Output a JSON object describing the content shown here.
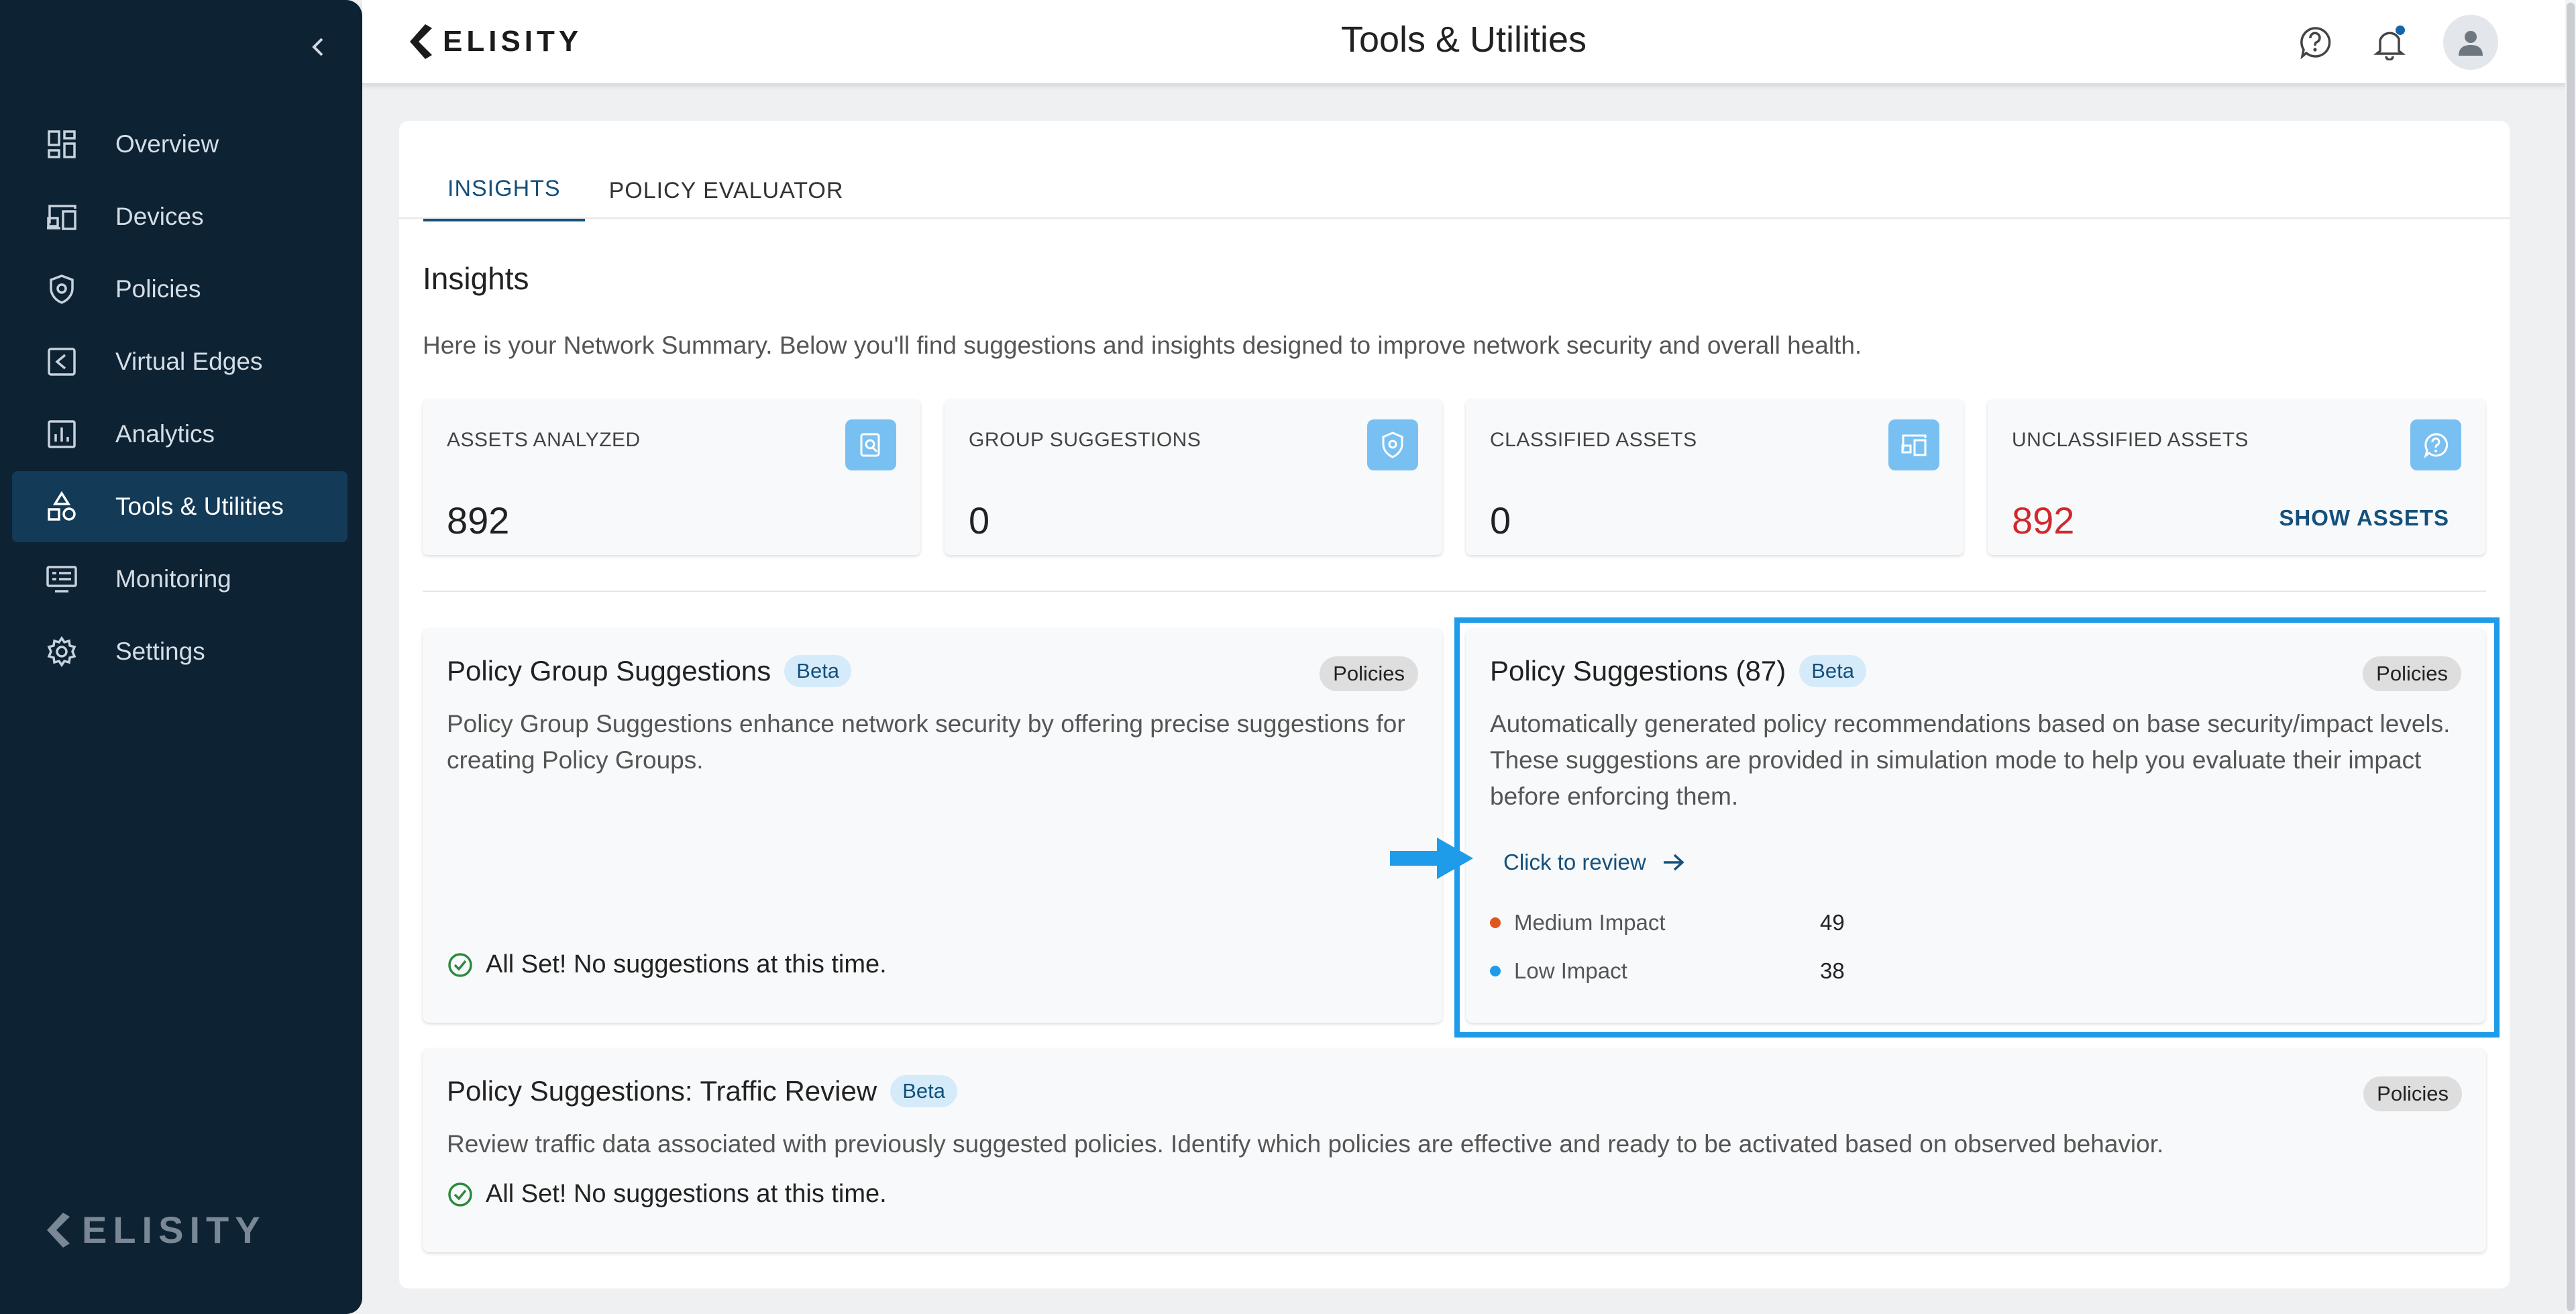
{
  "sidebar": {
    "items": [
      {
        "label": "Overview",
        "icon": "dashboard-icon"
      },
      {
        "label": "Devices",
        "icon": "devices-icon"
      },
      {
        "label": "Policies",
        "icon": "shield-icon"
      },
      {
        "label": "Virtual Edges",
        "icon": "edge-icon"
      },
      {
        "label": "Analytics",
        "icon": "analytics-icon"
      },
      {
        "label": "Tools & Utilities",
        "icon": "tools-icon",
        "active": true
      },
      {
        "label": "Monitoring",
        "icon": "monitor-icon"
      },
      {
        "label": "Settings",
        "icon": "gear-icon"
      }
    ],
    "logo_text": "ELISITY"
  },
  "header": {
    "brand": "ELISITY",
    "title": "Tools & Utilities"
  },
  "tabs": [
    {
      "label": "INSIGHTS",
      "active": true
    },
    {
      "label": "POLICY EVALUATOR",
      "active": false
    }
  ],
  "insights": {
    "title": "Insights",
    "subtitle": "Here is your Network Summary. Below you'll find suggestions and insights designed to improve network security and overall health."
  },
  "stats": [
    {
      "label": "ASSETS ANALYZED",
      "value": "892",
      "icon": "asset-search-icon"
    },
    {
      "label": "GROUP SUGGESTIONS",
      "value": "0",
      "icon": "group-shield-icon"
    },
    {
      "label": "CLASSIFIED ASSETS",
      "value": "0",
      "icon": "classified-devices-icon"
    },
    {
      "label": "UNCLASSIFIED ASSETS",
      "value": "892",
      "icon": "question-icon",
      "action": "SHOW ASSETS"
    }
  ],
  "cards": {
    "group": {
      "title": "Policy Group Suggestions",
      "badge": "Beta",
      "tag": "Policies",
      "description": "Policy Group Suggestions enhance network security by offering precise suggestions for creating Policy Groups.",
      "status": "All Set! No suggestions at this time."
    },
    "suggestions": {
      "title": "Policy Suggestions (87)",
      "badge": "Beta",
      "tag": "Policies",
      "description": "Automatically generated policy recommendations based on base security/impact levels. These suggestions are provided in simulation mode to help you evaluate their impact before enforcing them.",
      "review": "Click to review",
      "impacts": [
        {
          "label": "Medium Impact",
          "value": "49",
          "color": "#e0561f"
        },
        {
          "label": "Low Impact",
          "value": "38",
          "color": "#1e9be9"
        }
      ]
    },
    "traffic": {
      "title": "Policy Suggestions: Traffic Review",
      "badge": "Beta",
      "tag": "Policies",
      "description": "Review traffic data associated with previously suggested policies. Identify which policies are effective and ready to be activated based on observed behavior.",
      "status": "All Set! No suggestions at this time."
    }
  },
  "colors": {
    "sidebar_bg": "#0d2233",
    "accent": "#14507c",
    "highlight": "#1e9be9",
    "alert_red": "#d0292e"
  }
}
